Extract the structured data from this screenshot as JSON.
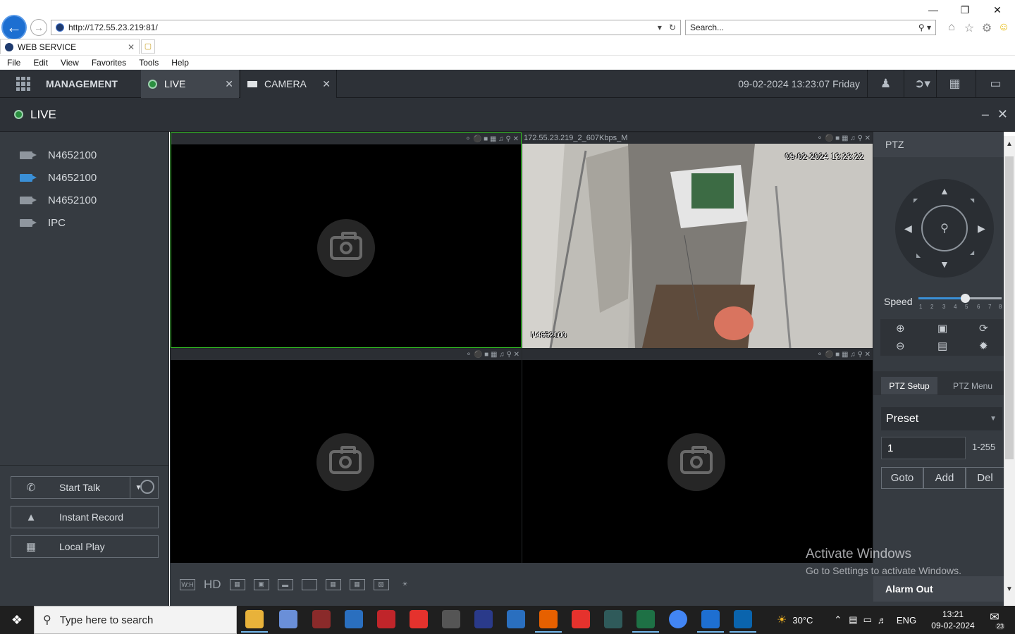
{
  "browser": {
    "url": "http://172.55.23.219:81/",
    "search_placeholder": "Search...",
    "tab_title": "WEB SERVICE",
    "menu": [
      "File",
      "Edit",
      "View",
      "Favorites",
      "Tools",
      "Help"
    ]
  },
  "app": {
    "management_label": "MANAGEMENT",
    "tabs": [
      {
        "label": "LIVE",
        "active": true
      },
      {
        "label": "CAMERA",
        "active": false
      }
    ],
    "datetime": "09-02-2024 13:23:07 Friday",
    "live_title": "LIVE"
  },
  "devices": [
    {
      "name": "N4652100",
      "active": false
    },
    {
      "name": "N4652100",
      "active": true
    },
    {
      "name": "N4652100",
      "active": false
    },
    {
      "name": "IPC",
      "active": false
    }
  ],
  "actions": {
    "start_talk": "Start Talk",
    "instant_record": "Instant Record",
    "local_play": "Local Play"
  },
  "video": {
    "channel_2_stream": "172.55.23.219_2_607Kbps_M",
    "osd_time": "09-02-2024 13:23:22",
    "osd_name": "N4652100"
  },
  "toolbar": {
    "wh_label": "W:H",
    "hd_label": "HD"
  },
  "ptz": {
    "title": "PTZ",
    "speed_label": "Speed",
    "speed_ticks": [
      "1",
      "2",
      "3",
      "4",
      "5",
      "6",
      "7",
      "8"
    ],
    "speed_value": 5,
    "setup_tab": "PTZ Setup",
    "menu_tab": "PTZ Menu",
    "preset_select": "Preset",
    "preset_value": "1",
    "preset_range": "1-255",
    "goto": "Goto",
    "add": "Add",
    "del": "Del",
    "alarm_out": "Alarm Out"
  },
  "watermark": {
    "line1": "Activate Windows",
    "line2": "Go to Settings to activate Windows."
  },
  "taskbar": {
    "search_placeholder": "Type here to search",
    "temperature": "30°C",
    "language": "ENG",
    "time": "13:21",
    "date": "09-02-2024",
    "notifications": "23"
  },
  "colors": {
    "accent_blue": "#3a8fd6",
    "live_green": "#2a8f3f",
    "selected_border": "#34c324",
    "panel_bg": "#363b41"
  }
}
